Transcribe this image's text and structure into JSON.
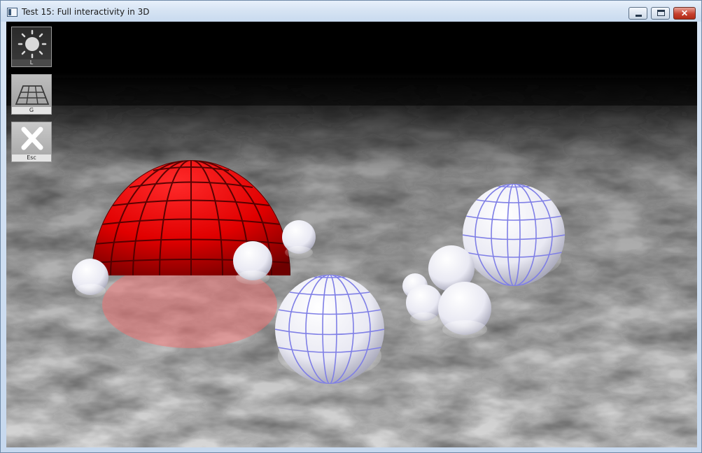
{
  "window": {
    "title": "Test 15: Full interactivity in 3D",
    "controls": {
      "minimize": "",
      "maximize": "",
      "close": "✕"
    }
  },
  "toolbar": {
    "light_key": "L",
    "grid_key": "G",
    "exit_key": "Esc"
  },
  "icons": {
    "light": "sun-icon",
    "grid": "grid-plane-icon",
    "exit": "close-x-icon"
  },
  "colors": {
    "red_dome": "#e00000",
    "sphere_grid": "#7f7fe6",
    "sky": "#000000"
  }
}
